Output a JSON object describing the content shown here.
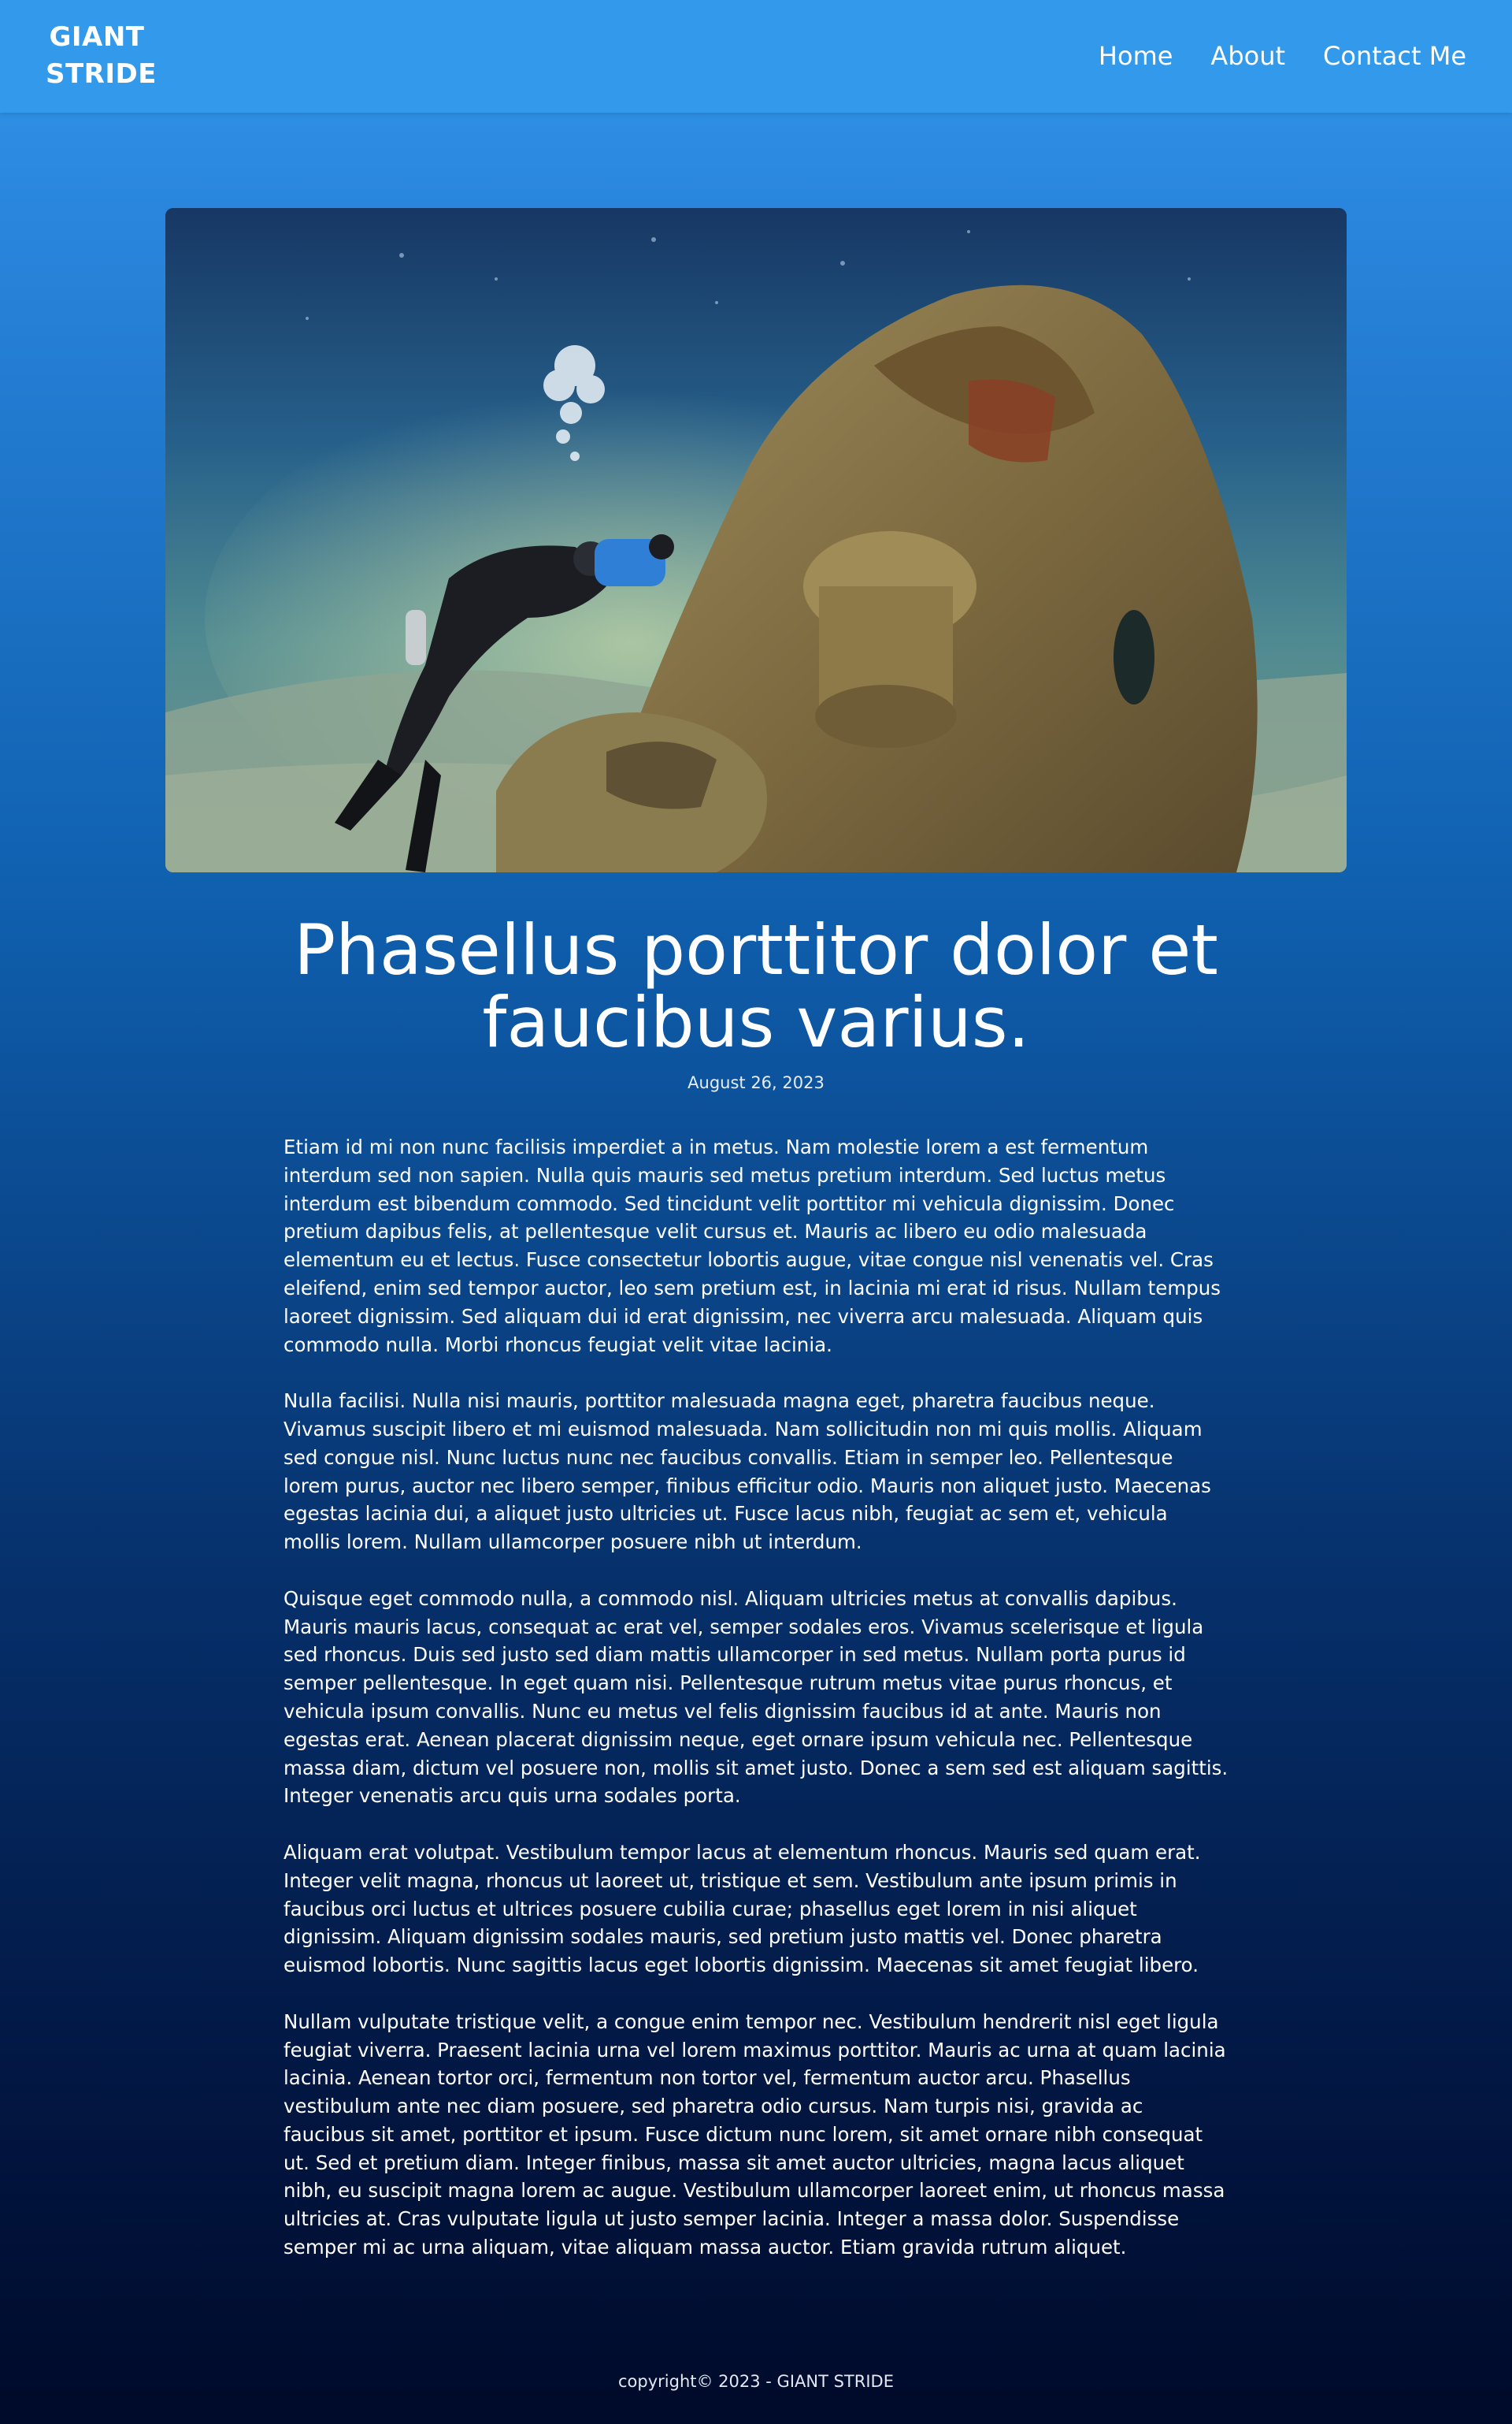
{
  "brand": {
    "name": "GIANT STRIDE"
  },
  "nav": {
    "items": [
      {
        "label": "Home"
      },
      {
        "label": "About"
      },
      {
        "label": "Contact Me"
      }
    ]
  },
  "hero": {
    "icon": "underwater-shipwreck-photo"
  },
  "post": {
    "title": "Phasellus porttitor dolor et faucibus varius.",
    "date": "August 26, 2023",
    "paragraphs": [
      "Etiam id mi non nunc facilisis imperdiet a in metus. Nam molestie lorem a est fermentum interdum sed non sapien. Nulla quis mauris sed metus pretium interdum. Sed luctus metus interdum est bibendum commodo. Sed tincidunt velit porttitor mi vehicula dignissim. Donec pretium dapibus felis, at pellentesque velit cursus et. Mauris ac libero eu odio malesuada elementum eu et lectus. Fusce consectetur lobortis augue, vitae congue nisl venenatis vel. Cras eleifend, enim sed tempor auctor, leo sem pretium est, in lacinia mi erat id risus. Nullam tempus laoreet dignissim. Sed aliquam dui id erat dignissim, nec viverra arcu malesuada. Aliquam quis commodo nulla. Morbi rhoncus feugiat velit vitae lacinia.",
      "Nulla facilisi. Nulla nisi mauris, porttitor malesuada magna eget, pharetra faucibus neque. Vivamus suscipit libero et mi euismod malesuada. Nam sollicitudin non mi quis mollis. Aliquam sed congue nisl. Nunc luctus nunc nec faucibus convallis. Etiam in semper leo. Pellentesque lorem purus, auctor nec libero semper, finibus efficitur odio. Mauris non aliquet justo. Maecenas egestas lacinia dui, a aliquet justo ultricies ut. Fusce lacus nibh, feugiat ac sem et, vehicula mollis lorem. Nullam ullamcorper posuere nibh ut interdum.",
      "Quisque eget commodo nulla, a commodo nisl. Aliquam ultricies metus at convallis dapibus. Mauris mauris lacus, consequat ac erat vel, semper sodales eros. Vivamus scelerisque et ligula sed rhoncus. Duis sed justo sed diam mattis ullamcorper in sed metus. Nullam porta purus id semper pellentesque. In eget quam nisi. Pellentesque rutrum metus vitae purus rhoncus, et vehicula ipsum convallis. Nunc eu metus vel felis dignissim faucibus id at ante. Mauris non egestas erat. Aenean placerat dignissim neque, eget ornare ipsum vehicula nec. Pellentesque massa diam, dictum vel posuere non, mollis sit amet justo. Donec a sem sed est aliquam sagittis. Integer venenatis arcu quis urna sodales porta.",
      "Aliquam erat volutpat. Vestibulum tempor lacus at elementum rhoncus. Mauris sed quam erat. Integer velit magna, rhoncus ut laoreet ut, tristique et sem. Vestibulum ante ipsum primis in faucibus orci luctus et ultrices posuere cubilia curae; phasellus eget lorem in nisi aliquet dignissim. Aliquam dignissim sodales mauris, sed pretium justo mattis vel. Donec pharetra euismod lobortis. Nunc sagittis lacus eget lobortis dignissim. Maecenas sit amet feugiat libero.",
      "Nullam vulputate tristique velit, a congue enim tempor nec. Vestibulum hendrerit nisl eget ligula feugiat viverra. Praesent lacinia urna vel lorem maximus porttitor. Mauris ac urna at quam lacinia lacinia. Aenean tortor orci, fermentum non tortor vel, fermentum auctor arcu. Phasellus vestibulum ante nec diam posuere, sed pharetra odio cursus. Nam turpis nisi, gravida ac faucibus sit amet, porttitor et ipsum. Fusce dictum nunc lorem, sit amet ornare nibh consequat ut. Sed et pretium diam. Integer finibus, massa sit amet auctor ultricies, magna lacus aliquet nibh, eu suscipit magna lorem ac augue. Vestibulum ullamcorper laoreet enim, ut rhoncus massa ultricies at. Cras vulputate ligula ut justo semper lacinia. Integer a massa dolor. Suspendisse semper mi ac urna aliquam, vitae aliquam massa auctor. Etiam gravida rutrum aliquet."
    ]
  },
  "footer": {
    "text": "copyright© 2023 - GIANT STRIDE"
  },
  "colors": {
    "header_bg": "#3399ea",
    "gradient_top": "#2a86dd",
    "gradient_bottom": "#000a2a",
    "text": "#ffffff"
  }
}
